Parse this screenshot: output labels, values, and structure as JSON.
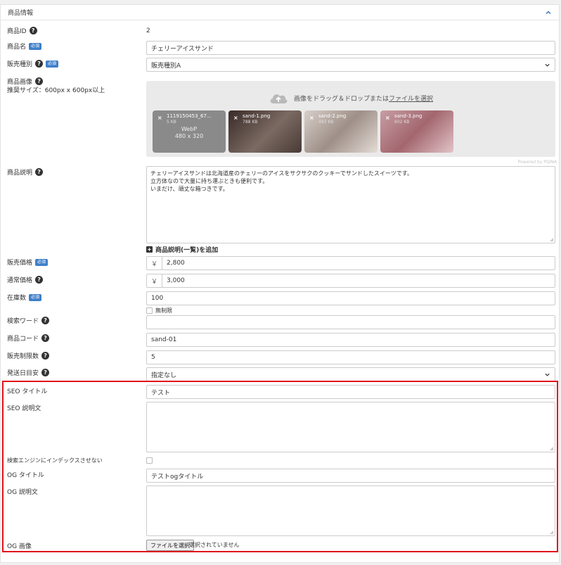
{
  "card": {
    "title": "商品情報"
  },
  "badges": {
    "required": "必須"
  },
  "fields": {
    "product_id": {
      "label": "商品ID",
      "value": "2"
    },
    "product_name": {
      "label": "商品名",
      "value": "チェリーアイスサンド"
    },
    "sales_type": {
      "label": "販売種別",
      "value": "販売種別A"
    },
    "product_image": {
      "label": "商品画像",
      "hint": "推奨サイズ：600px x 600px以上"
    },
    "description": {
      "label": "商品説明",
      "lines": [
        "チェリーアイスサンドは北海道産のチェリーのアイスをサクサクのクッキーでサンドしたスイーツです。",
        "立方体なので大量に持ち運ぶときも便利です。",
        "いまだけ、頑丈な箱つきです。"
      ]
    },
    "add_list_description": {
      "label": "商品説明(一覧)を追加"
    },
    "sale_price": {
      "label": "販売価格",
      "currency": "￥",
      "value": "2,800"
    },
    "regular_price": {
      "label": "通常価格",
      "currency": "￥",
      "value": "3,000"
    },
    "stock": {
      "label": "在庫数",
      "value": "100",
      "unlimited_label": "無制限"
    },
    "search_word": {
      "label": "検索ワード",
      "value": ""
    },
    "product_code": {
      "label": "商品コード",
      "value": "sand-01"
    },
    "sale_limit": {
      "label": "販売制限数",
      "value": "5"
    },
    "delivery_estimate": {
      "label": "発送日目安",
      "value": "指定なし"
    },
    "seo_title": {
      "label": "SEO タイトル",
      "value": "テスト"
    },
    "seo_description": {
      "label": "SEO 説明文",
      "value": ""
    },
    "noindex": {
      "label": "検索エンジンにインデックスさせない"
    },
    "og_title": {
      "label": "OG タイトル",
      "value": "テストogタイトル"
    },
    "og_description": {
      "label": "OG 説明文",
      "value": ""
    },
    "og_image": {
      "label": "OG 画像",
      "button": "ファイルを選択",
      "status": "選択されていません"
    }
  },
  "dropzone": {
    "text": "画像をドラッグ＆ドロップまたは",
    "link": "ファイルを選択",
    "powered": "Powered by PQINA",
    "thumbs": [
      {
        "name": "1119150453_67...",
        "size": "5 KB",
        "format": "WebP",
        "dims": "480 x 320",
        "bg": "#8a8a8a"
      },
      {
        "name": "sand-1.png",
        "size": "788 KB",
        "bg": "#5a4a46"
      },
      {
        "name": "sand-2.png",
        "size": "483 KB",
        "bg": "#a89a92"
      },
      {
        "name": "sand-3.png",
        "size": "602 KB",
        "bg": "#b5868c"
      }
    ]
  },
  "colors": {
    "required_badge": "#3f7fc9",
    "highlight_border": "#e0121a"
  }
}
